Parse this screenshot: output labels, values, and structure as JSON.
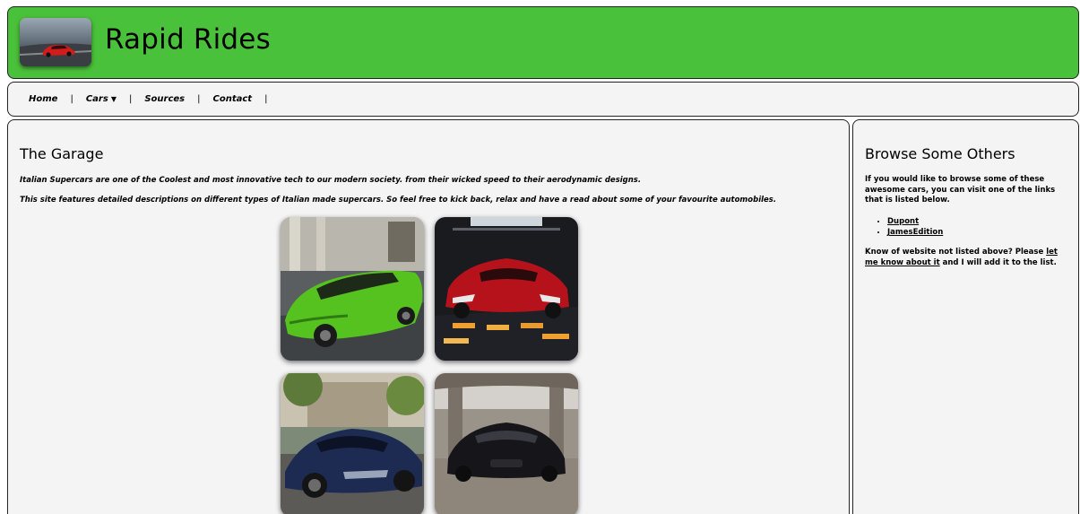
{
  "site": {
    "title": "Rapid Rides",
    "logo_icon": "red-supercar-logo-icon"
  },
  "nav": {
    "items": [
      {
        "label": "Home"
      },
      {
        "label": "Cars"
      },
      {
        "label": "Sources"
      },
      {
        "label": "Contact"
      }
    ],
    "cars_caret": "▼",
    "separator": "|"
  },
  "main": {
    "heading": "The Garage",
    "paragraph1": "Italian Supercars are one of the Coolest and most innovative tech to our modern society. from their wicked speed to their aerodynamic designs.",
    "paragraph2": "This site features detailed descriptions on different types of Italian made supercars. So feel free to kick back, relax and have a read about some of your favourite automobiles.",
    "gallery": [
      {
        "icon": "green-lamborghini-image"
      },
      {
        "icon": "red-ferrari-image"
      },
      {
        "icon": "blue-pagani-image"
      },
      {
        "icon": "black-maserati-image"
      }
    ]
  },
  "aside": {
    "heading": "Browse Some Others",
    "intro": "If you would like to browse some of these awesome cars, you can visit one of the links that is listed below.",
    "links": [
      {
        "label": "Dupont"
      },
      {
        "label": "JamesEdition"
      }
    ],
    "outro_before": "Know of website not listed above? Please ",
    "outro_link": "let me know about it",
    "outro_after": " and I will add it to the list."
  },
  "colors": {
    "header_green": "#4ac13a",
    "panel_bg": "#f4f4f4"
  }
}
